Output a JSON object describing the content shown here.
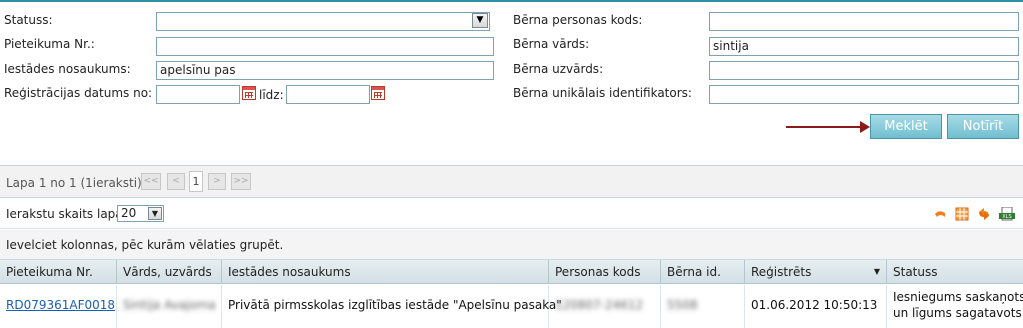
{
  "filters": {
    "status_label": "Statuss:",
    "status_value": "",
    "application_no_label": "Pieteikuma Nr.:",
    "application_no_value": "",
    "institution_label": "Iestādes nosaukums:",
    "institution_value": "apelsīnu pas",
    "reg_date_label": "Reģistrācijas datums no:",
    "reg_date_from": "",
    "reg_date_to_label": "līdz:",
    "reg_date_to": "",
    "child_personal_code_label": "Bērna personas kods:",
    "child_personal_code_value": "",
    "child_name_label": "Bērna vārds:",
    "child_name_value": "sintija",
    "child_surname_label": "Bērna uzvārds:",
    "child_surname_value": "",
    "child_uid_label": "Bērna unikālais identifikators:",
    "child_uid_value": ""
  },
  "buttons": {
    "search": "Meklēt",
    "clear": "Notīrīt"
  },
  "pager": {
    "summary": "Lapa 1 no 1 (1ieraksti)",
    "first": "<<",
    "prev": "<",
    "current": "1",
    "next": ">",
    "last": ">>"
  },
  "page_size": {
    "label": "Ierakstu skaits lapā:",
    "value": "20"
  },
  "toolbar_icons": [
    "undo-icon",
    "excel-icon",
    "refresh-icon",
    "export-xls-icon"
  ],
  "group_hint": "Ievelciet kolonnas, pēc kurām vēlaties grupēt.",
  "grid": {
    "columns": [
      "Pieteikuma Nr.",
      "Vārds, uzvārds",
      "Iestādes nosaukums",
      "Personas kods",
      "Bērna id.",
      "Reģistrēts",
      "Statuss"
    ],
    "rows": [
      {
        "application_no": "RD079361AF0018",
        "name": "Sintija Avajoma",
        "institution": "Privātā pirmsskolas izglītības iestāde \"Apelsīnu pasaka\"",
        "personal_code": "120807-24612",
        "child_id": "5508",
        "registered": "01.06.2012 10:50:13",
        "status_line1": "Iesniegums saskaņots",
        "status_line2": "un līgums sagatavots"
      }
    ]
  },
  "colors": {
    "accent": "#2e8fa6",
    "button_bg": "#6fbfd0",
    "arrow": "#8b1a1a",
    "link": "#1a5fb4"
  }
}
